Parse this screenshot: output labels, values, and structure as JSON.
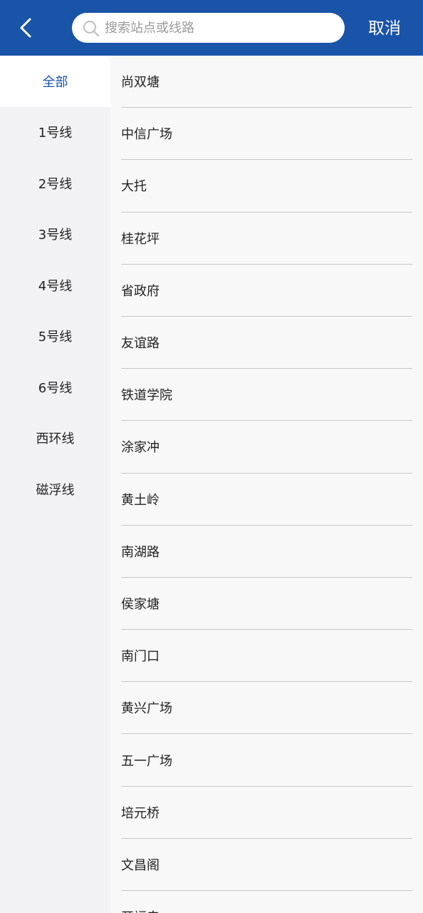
{
  "header": {
    "search_placeholder": "搜索站点或线路",
    "cancel_label": "取消"
  },
  "colors": {
    "brand": "#1a54a8",
    "active_text": "#1a54a8"
  },
  "sidebar": {
    "items": [
      {
        "label": "全部",
        "active": true
      },
      {
        "label": "1号线"
      },
      {
        "label": "2号线"
      },
      {
        "label": "3号线"
      },
      {
        "label": "4号线"
      },
      {
        "label": "5号线"
      },
      {
        "label": "6号线"
      },
      {
        "label": "西环线"
      },
      {
        "label": "磁浮线"
      }
    ]
  },
  "stations": [
    "尚双塘",
    "中信广场",
    "大托",
    "桂花坪",
    "省政府",
    "友谊路",
    "铁道学院",
    "涂家冲",
    "黄土岭",
    "南湖路",
    "侯家塘",
    "南门口",
    "黄兴广场",
    "五一广场",
    "培元桥",
    "文昌阁",
    "开福寺"
  ]
}
